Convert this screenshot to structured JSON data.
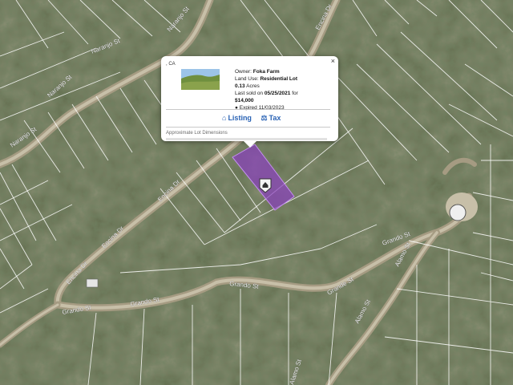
{
  "popup": {
    "header": ", CA",
    "close_glyph": "×",
    "owner_label": "Owner:",
    "owner_value": "Foka Farm",
    "land_use_label": "Land Use:",
    "land_use_value": "Residential Lot",
    "acres_value": "0.13",
    "acres_unit": "Acres",
    "last_sold_prefix": "Last sold on",
    "last_sold_date": "05/25/2021",
    "last_sold_for": "for",
    "last_sold_price": "$14,000",
    "expired_text": "Expired 11/03/2023",
    "listing_label": "Listing",
    "tax_label": "Tax",
    "footnote": "Approximate Lot Dimensions"
  },
  "streets": {
    "naranjo_1": "Naranjo St",
    "naranjo_2": "Naranjo St",
    "naranjo_3": "Naranjo St",
    "encina_upper": "Encina Dr",
    "encina_mid": "Encina Dr",
    "encina_left": "Encina Dr",
    "encina_top": "Encina Dr",
    "grando_1": "Grando St",
    "grando_2": "Grando St",
    "grando_3": "Grando St",
    "grando_4": "Grando St",
    "grando_right": "Grando St",
    "grande_st": "Grande St",
    "alamo_1": "Alamo St",
    "alamo_2": "Alamo St",
    "alamo_3": "Alamo St"
  },
  "colors": {
    "parcel_fill": "#8a3fbf",
    "link": "#2a63b5",
    "lot_lines": "#ffffff"
  },
  "icons": {
    "listing": "house-icon",
    "tax": "bank-icon",
    "expired": "map-pin-icon",
    "parcel_marker": "house-marker-icon"
  }
}
